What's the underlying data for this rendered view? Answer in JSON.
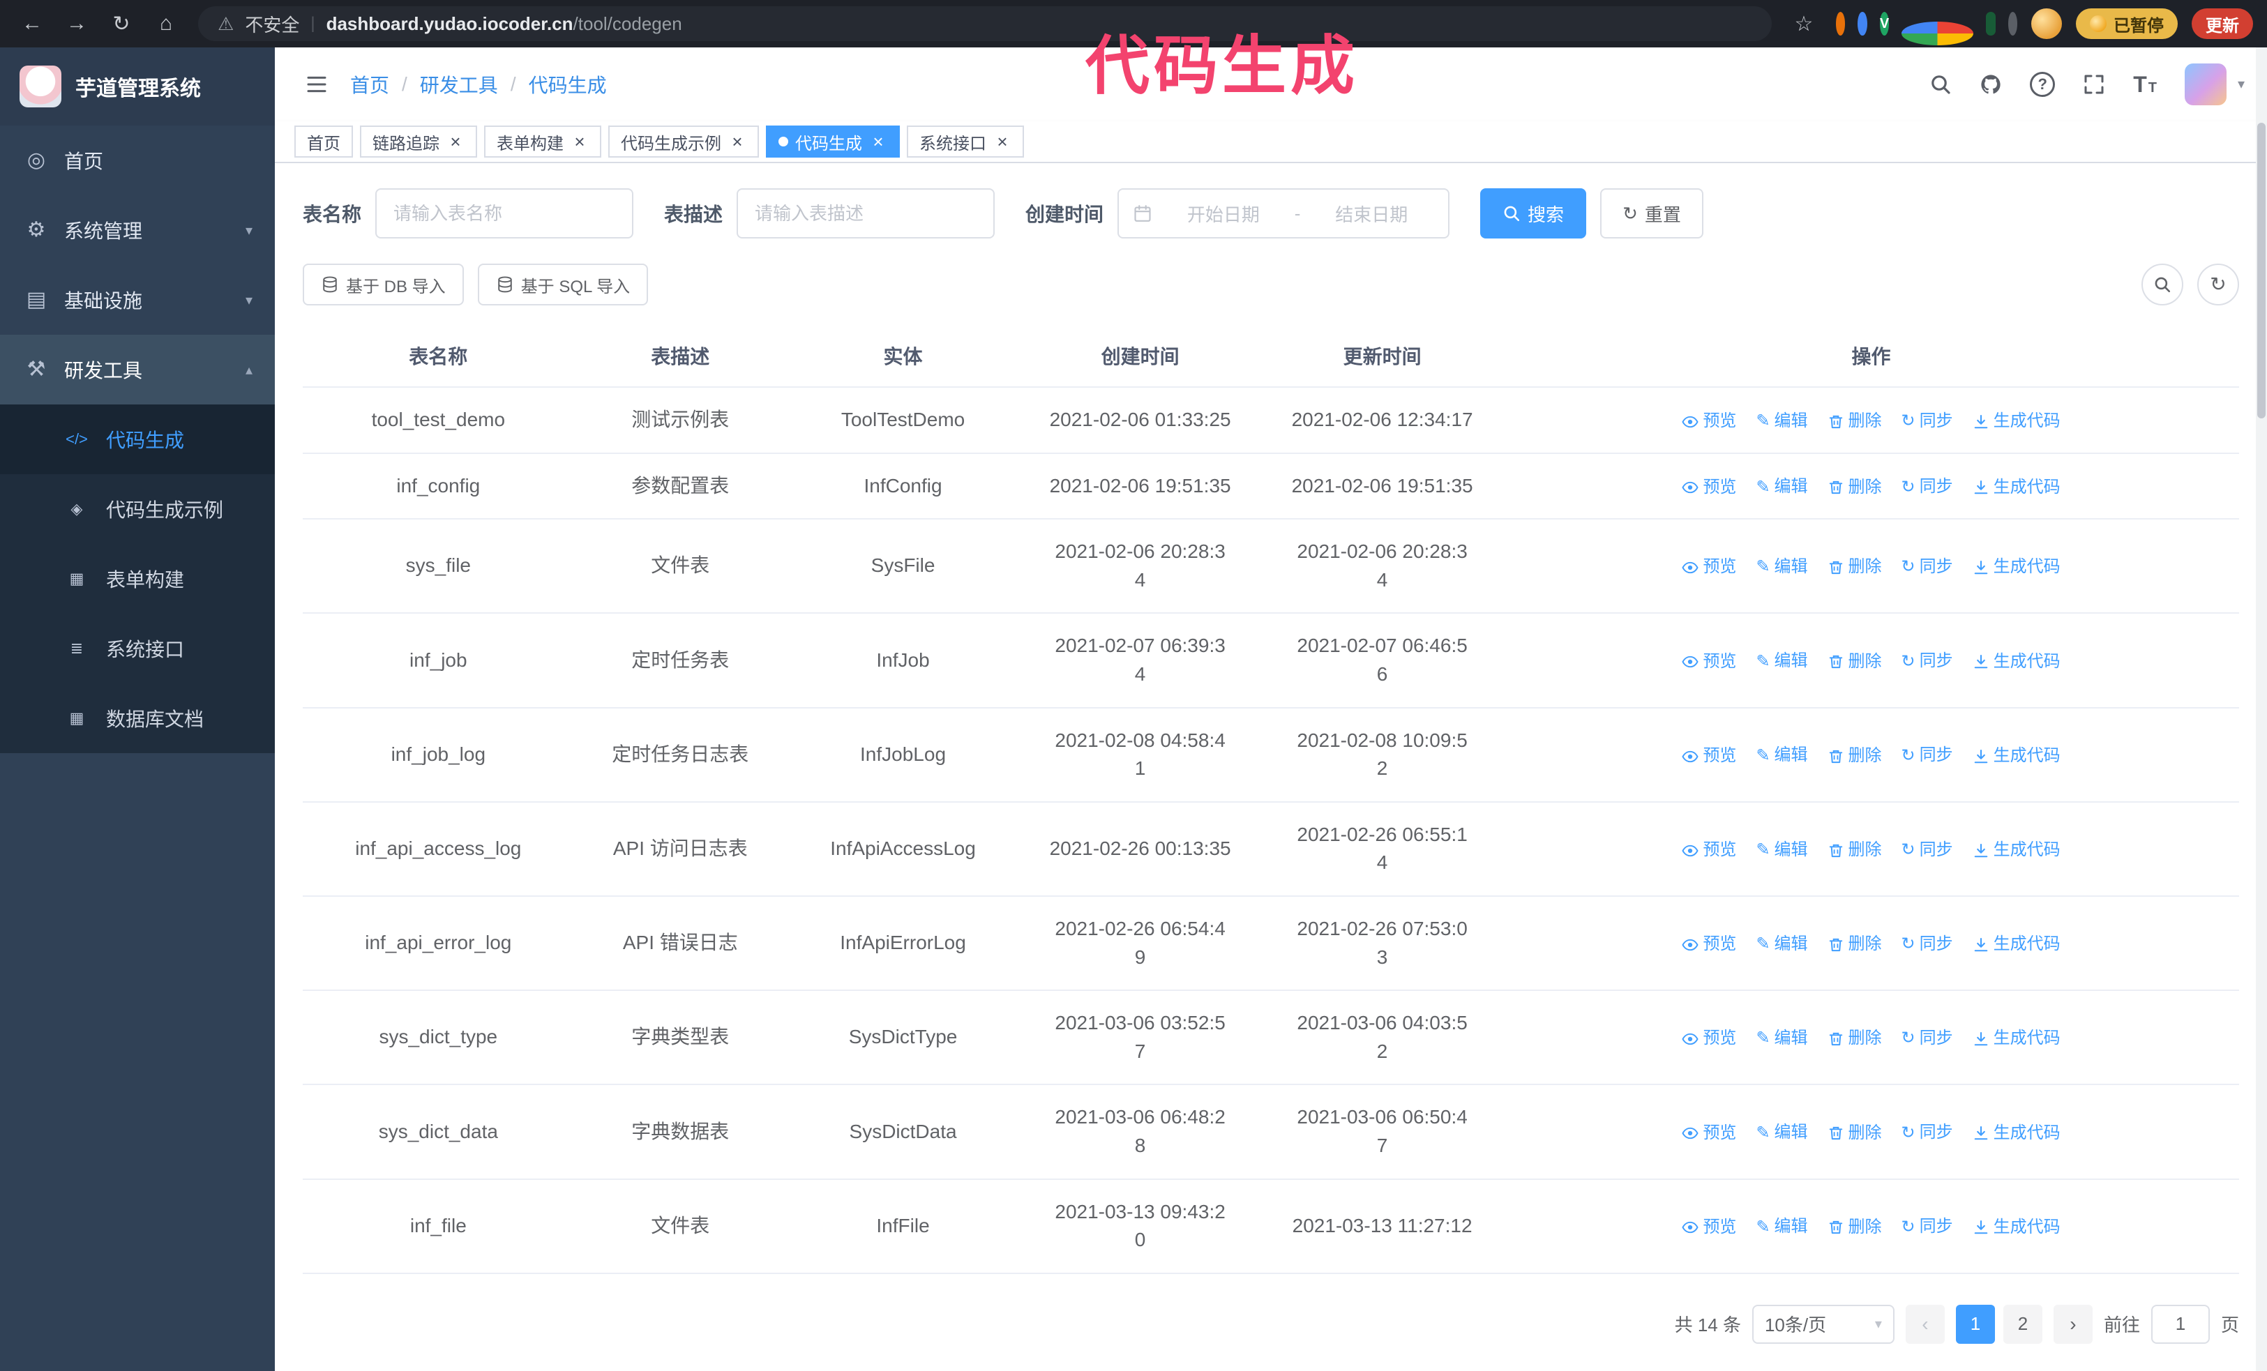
{
  "theme": {
    "accent": "#409eff",
    "annotation": "#f3436e",
    "sidebar_bg": "#304156",
    "submenu_bg": "#1f2d3d",
    "chrome_bg": "#1e2128"
  },
  "browser": {
    "security_label": "不安全",
    "url_host": "dashboard.yudao.iocoder.cn",
    "url_path": "/tool/codegen",
    "paused_badge": "已暂停",
    "update_button": "更新",
    "extensions": [
      {
        "color": "#e8710a",
        "shape": "circle"
      },
      {
        "color": "#4285f4",
        "shape": "circle"
      },
      {
        "color": "#1fa463",
        "shape": "circle",
        "letter": "V"
      },
      {
        "color": "grid",
        "shape": "circle"
      },
      {
        "color": "#185c37",
        "shape": "square"
      },
      {
        "color": "#5b5f66",
        "shape": "circle"
      }
    ]
  },
  "annotation": {
    "text": "代码生成"
  },
  "sidebar": {
    "logo_title": "芋道管理系统",
    "items": [
      {
        "label": "首页",
        "icon": "home-icon"
      },
      {
        "label": "系统管理",
        "icon": "gear-icon",
        "chevron": "down"
      },
      {
        "label": "基础设施",
        "icon": "infra-icon",
        "chevron": "down"
      },
      {
        "label": "研发工具",
        "icon": "tools-icon",
        "chevron": "up",
        "active": true
      }
    ],
    "sub_items": [
      {
        "label": "代码生成",
        "icon": "code-icon",
        "active": true
      },
      {
        "label": "代码生成示例",
        "icon": "example-icon"
      },
      {
        "label": "表单构建",
        "icon": "form-icon"
      },
      {
        "label": "系统接口",
        "icon": "api-icon"
      },
      {
        "label": "数据库文档",
        "icon": "dbdoc-icon"
      }
    ]
  },
  "header": {
    "breadcrumb": [
      "首页",
      "研发工具",
      "代码生成"
    ],
    "separator": "/"
  },
  "tabs": [
    {
      "label": "首页",
      "closable": false,
      "active": false
    },
    {
      "label": "链路追踪",
      "closable": true,
      "active": false
    },
    {
      "label": "表单构建",
      "closable": true,
      "active": false
    },
    {
      "label": "代码生成示例",
      "closable": true,
      "active": false
    },
    {
      "label": "代码生成",
      "closable": true,
      "active": true
    },
    {
      "label": "系统接口",
      "closable": true,
      "active": false
    }
  ],
  "filters": {
    "table_name_label": "表名称",
    "table_name_placeholder": "请输入表名称",
    "table_desc_label": "表描述",
    "table_desc_placeholder": "请输入表描述",
    "create_time_label": "创建时间",
    "date_start_placeholder": "开始日期",
    "date_separator": "-",
    "date_end_placeholder": "结束日期",
    "search_button": "搜索",
    "reset_button": "重置"
  },
  "toolbar": {
    "import_db": "基于 DB 导入",
    "import_sql": "基于 SQL 导入"
  },
  "table": {
    "columns": [
      "表名称",
      "表描述",
      "实体",
      "创建时间",
      "更新时间",
      "操作"
    ],
    "actions": [
      {
        "label": "预览",
        "icon": "eye-icon"
      },
      {
        "label": "编辑",
        "icon": "edit-icon"
      },
      {
        "label": "删除",
        "icon": "delete-icon"
      },
      {
        "label": "同步",
        "icon": "sync-icon"
      },
      {
        "label": "生成代码",
        "icon": "download-icon"
      }
    ],
    "rows": [
      {
        "name": "tool_test_demo",
        "desc": "测试示例表",
        "entity": "ToolTestDemo",
        "created": "2021-02-06 01:33:25",
        "updated": "2021-02-06 12:34:17"
      },
      {
        "name": "inf_config",
        "desc": "参数配置表",
        "entity": "InfConfig",
        "created": "2021-02-06 19:51:35",
        "updated": "2021-02-06 19:51:35"
      },
      {
        "name": "sys_file",
        "desc": "文件表",
        "entity": "SysFile",
        "created": "2021-02-06 20:28:3\n4",
        "updated": "2021-02-06 20:28:3\n4"
      },
      {
        "name": "inf_job",
        "desc": "定时任务表",
        "entity": "InfJob",
        "created": "2021-02-07 06:39:3\n4",
        "updated": "2021-02-07 06:46:5\n6"
      },
      {
        "name": "inf_job_log",
        "desc": "定时任务日志表",
        "entity": "InfJobLog",
        "created": "2021-02-08 04:58:4\n1",
        "updated": "2021-02-08 10:09:5\n2"
      },
      {
        "name": "inf_api_access_log",
        "desc": "API 访问日志表",
        "entity": "InfApiAccessLog",
        "created": "2021-02-26 00:13:35",
        "updated": "2021-02-26 06:55:1\n4"
      },
      {
        "name": "inf_api_error_log",
        "desc": "API 错误日志",
        "entity": "InfApiErrorLog",
        "created": "2021-02-26 06:54:4\n9",
        "updated": "2021-02-26 07:53:0\n3"
      },
      {
        "name": "sys_dict_type",
        "desc": "字典类型表",
        "entity": "SysDictType",
        "created": "2021-03-06 03:52:5\n7",
        "updated": "2021-03-06 04:03:5\n2"
      },
      {
        "name": "sys_dict_data",
        "desc": "字典数据表",
        "entity": "SysDictData",
        "created": "2021-03-06 06:48:2\n8",
        "updated": "2021-03-06 06:50:4\n7"
      },
      {
        "name": "inf_file",
        "desc": "文件表",
        "entity": "InfFile",
        "created": "2021-03-13 09:43:2\n0",
        "updated": "2021-03-13 11:27:12"
      }
    ]
  },
  "pagination": {
    "total": "共 14 条",
    "page_size": "10条/页",
    "pages": [
      "1",
      "2"
    ],
    "active_page": "1",
    "goto_label": "前往",
    "goto_value": "1",
    "goto_suffix": "页"
  }
}
